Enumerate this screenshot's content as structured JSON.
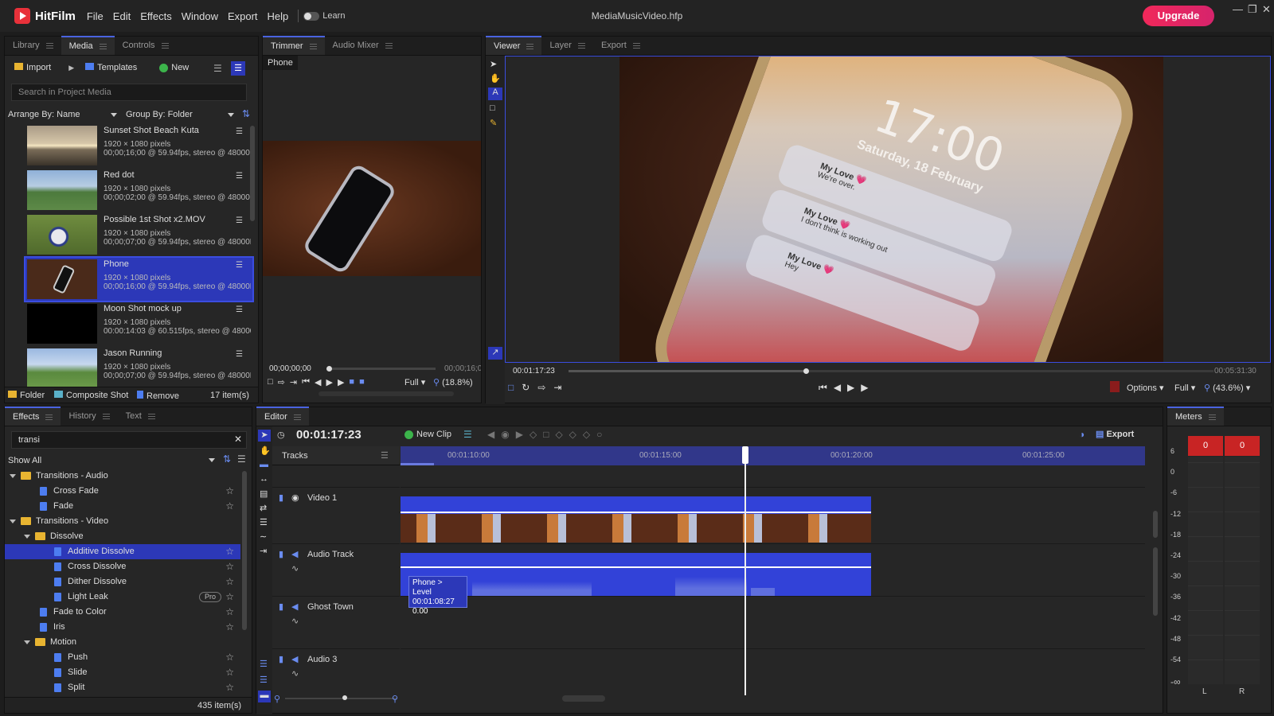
{
  "app": {
    "name": "HitFilm",
    "window_title": "MediaMusicVideo.hfp",
    "upgrade_label": "Upgrade"
  },
  "menu": [
    "File",
    "Edit",
    "Effects",
    "Window",
    "Export",
    "Help"
  ],
  "learn_label": "Learn",
  "left_panel": {
    "tabs": [
      "Library",
      "Media",
      "Controls"
    ],
    "buttons": {
      "import": "Import",
      "templates": "Templates",
      "new": "New"
    },
    "search_placeholder": "Search in Project Media",
    "arrange_by": "Arrange By: Name",
    "group_by": "Group By: Folder",
    "items": [
      {
        "name": "Sunset Shot Beach Kuta",
        "res": "1920 × 1080 pixels",
        "info": "00;00;16;00 @ 59.94fps, stereo @ 48000Hz"
      },
      {
        "name": "Red dot",
        "res": "1920 × 1080 pixels",
        "info": "00;00;02;00 @ 59.94fps, stereo @ 48000Hz"
      },
      {
        "name": "Possible 1st Shot x2.MOV",
        "res": "1920 × 1080 pixels",
        "info": "00;00;07;00 @ 59.94fps, stereo @ 48000Hz"
      },
      {
        "name": "Phone",
        "res": "1920 × 1080 pixels",
        "info": "00;00;16;00 @ 59.94fps, stereo @ 48000Hz"
      },
      {
        "name": "Moon Shot mock up",
        "res": "1920 × 1080 pixels",
        "info": "00:00:14:03 @ 60.515fps, stereo @ 48000Hz"
      },
      {
        "name": "Jason Running",
        "res": "1920 × 1080 pixels",
        "info": "00;00;07;00 @ 59.94fps, stereo @ 48000Hz"
      }
    ],
    "footer": {
      "folder": "Folder",
      "composite": "Composite Shot",
      "remove": "Remove",
      "count": "17 item(s)"
    }
  },
  "trimmer": {
    "tabs": [
      "Trimmer",
      "Audio Mixer"
    ],
    "clip_label": "Phone",
    "time_start": "00;00;00;00",
    "time_end": "00;00;16;00",
    "quality": "Full",
    "zoom": "(18.8%)"
  },
  "viewer": {
    "tabs": [
      "Viewer",
      "Layer",
      "Export"
    ],
    "phone_time": "17:00",
    "phone_date": "Saturday, 18 February",
    "notifications": [
      {
        "title": "My Love 💗",
        "body": "We're over."
      },
      {
        "title": "My Love 💗",
        "body": "I don't think is working out"
      },
      {
        "title": "My Love 💗",
        "body": "Hey"
      }
    ],
    "current_time": "00:01:17:23",
    "end_time": "00:05:31:30",
    "options": "Options",
    "quality": "Full",
    "zoom": "(43.6%)"
  },
  "effects": {
    "tabs": [
      "Effects",
      "History",
      "Text"
    ],
    "search_value": "transi",
    "filter": "Show All",
    "tree": [
      {
        "label": "Transitions - Audio",
        "kind": "folder",
        "level": 0,
        "open": true
      },
      {
        "label": "Cross Fade",
        "kind": "item",
        "level": 1
      },
      {
        "label": "Fade",
        "kind": "item",
        "level": 1
      },
      {
        "label": "Transitions - Video",
        "kind": "folder",
        "level": 0,
        "open": true
      },
      {
        "label": "Dissolve",
        "kind": "folder",
        "level": 1,
        "open": true
      },
      {
        "label": "Additive Dissolve",
        "kind": "item",
        "level": 2,
        "selected": true
      },
      {
        "label": "Cross Dissolve",
        "kind": "item",
        "level": 2
      },
      {
        "label": "Dither Dissolve",
        "kind": "item",
        "level": 2
      },
      {
        "label": "Light Leak",
        "kind": "item",
        "level": 2,
        "badge": "Pro"
      },
      {
        "label": "Fade to Color",
        "kind": "item",
        "level": 1
      },
      {
        "label": "Iris",
        "kind": "item",
        "level": 1
      },
      {
        "label": "Motion",
        "kind": "folder",
        "level": 1,
        "open": true
      },
      {
        "label": "Push",
        "kind": "item",
        "level": 2
      },
      {
        "label": "Slide",
        "kind": "item",
        "level": 2
      },
      {
        "label": "Split",
        "kind": "item",
        "level": 2
      }
    ],
    "count": "435 item(s)"
  },
  "editor": {
    "tab": "Editor",
    "timecode": "00:01:17:23",
    "new_clip": "New Clip",
    "export": "Export",
    "tracks_label": "Tracks",
    "ruler_marks": [
      "00:01:10:00",
      "00:01:15:00",
      "00:01:20:00",
      "00:01:25:00"
    ],
    "tracks": [
      "Video 1",
      "Audio Track",
      "Ghost Town",
      "Audio 3"
    ],
    "tooltip": {
      "line1": "Phone > Level",
      "line2": "00:01:08:27",
      "line3": "0.00"
    }
  },
  "meters": {
    "tab": "Meters",
    "peak_l": "0",
    "peak_r": "0",
    "scale": [
      "6",
      "0",
      "-6",
      "-12",
      "-18",
      "-24",
      "-30",
      "-36",
      "-42",
      "-48",
      "-54",
      "-∞"
    ],
    "channels": [
      "L",
      "R"
    ]
  }
}
